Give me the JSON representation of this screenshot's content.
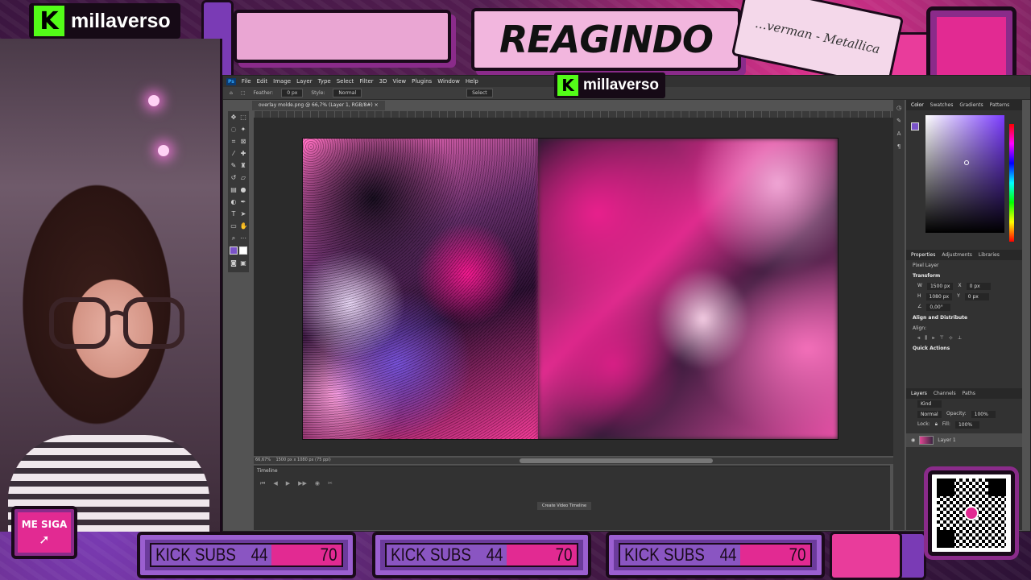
{
  "brand": {
    "name": "millaverso",
    "logo_letter": "K"
  },
  "header": {
    "title": "REAGINDO",
    "cassette_label": "…verman - Metallica"
  },
  "photoshop": {
    "menu": [
      "File",
      "Edit",
      "Image",
      "Layer",
      "Type",
      "Select",
      "Filter",
      "3D",
      "View",
      "Plugins",
      "Window",
      "Help"
    ],
    "options": {
      "feather_label": "Feather:",
      "feather_value": "0 px",
      "style_label": "Style:",
      "style_value": "Normal",
      "select_label": "Select"
    },
    "doc_tab": "overlay molde.png @ 66,7% (Layer 1, RGB/8#) ×",
    "status": {
      "zoom": "66,67%",
      "size": "1500 px x 1080 px (75 ppi)"
    },
    "timeline": {
      "title": "Timeline",
      "create_button": "Create Video Timeline"
    },
    "right_panel": {
      "color_tabs": [
        "Color",
        "Swatches",
        "Gradients",
        "Patterns"
      ],
      "prop_tabs": [
        "Properties",
        "Adjustments",
        "Libraries"
      ],
      "pixel_layer": "Pixel Layer",
      "transform_title": "Transform",
      "w_label": "W",
      "w_value": "1500 px",
      "x_label": "X",
      "x_value": "0 px",
      "h_label": "H",
      "h_value": "1080 px",
      "y_label": "Y",
      "y_value": "0 px",
      "angle_value": "0,00°",
      "align_title": "Align and Distribute",
      "align_label": "Align:",
      "quick_actions": "Quick Actions",
      "layer_tabs": [
        "Layers",
        "Channels",
        "Paths"
      ],
      "kind_label": "Kind",
      "blend_mode": "Normal",
      "opacity_label": "Opacity:",
      "opacity_value": "100%",
      "lock_label": "Lock:",
      "fill_label": "Fill:",
      "fill_value": "100%",
      "layer_name": "Layer 1"
    },
    "colors": {
      "foreground": "#7a53c8",
      "background": "#ffffff"
    }
  },
  "follow_button": {
    "label": "ME SIGA"
  },
  "sub_goals": [
    {
      "label": "KICK SUBS",
      "current": "44",
      "goal": "70",
      "progress": 0.63
    },
    {
      "label": "KICK SUBS",
      "current": "44",
      "goal": "70",
      "progress": 0.63
    },
    {
      "label": "KICK SUBS",
      "current": "44",
      "goal": "70",
      "progress": 0.63
    }
  ],
  "icons": [
    "kick-logo-icon",
    "cursor-icon",
    "qr-code-icon",
    "photoshop-logo-icon"
  ]
}
